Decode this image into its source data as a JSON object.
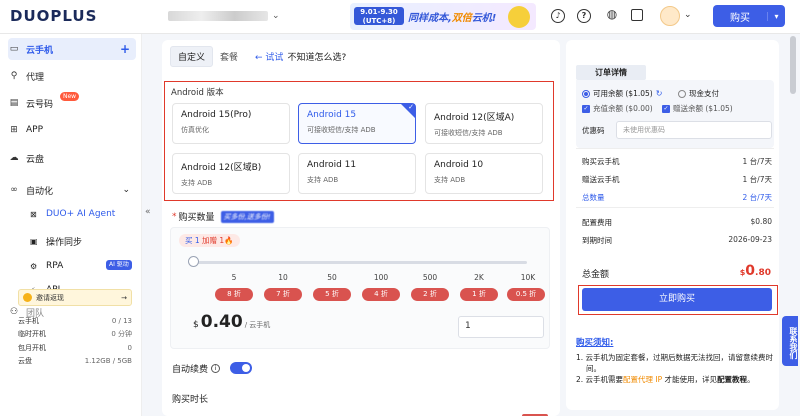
{
  "header": {
    "logo": "DUOPLUS",
    "banner": {
      "date_top": "9.01-9.30",
      "date_bottom": "(UTC+8)",
      "text_a": "同样成本,",
      "text_b": "双倍",
      "text_c": "云机!"
    },
    "buy_label": "购买",
    "buy_caret": "▾"
  },
  "sidebar": {
    "items": [
      {
        "label": "云手机",
        "icon": "phone-icon",
        "plus": "+"
      },
      {
        "label": "代理",
        "icon": "proxy-icon"
      },
      {
        "label": "云号码",
        "icon": "sim-icon",
        "badge": "New"
      },
      {
        "label": "APP",
        "icon": "grid-icon"
      },
      {
        "label": "云盘",
        "icon": "cloud-icon"
      },
      {
        "label": "自动化",
        "icon": "infinity-icon"
      }
    ],
    "sub": [
      {
        "label": "DUO+ AI Agent"
      },
      {
        "label": "操作同步"
      },
      {
        "label": "RPA",
        "badge": "AI 驱动"
      },
      {
        "label": "API"
      }
    ],
    "partial": "团队",
    "invite": "邀请返现",
    "invite_arrow": "→",
    "stats": [
      {
        "label": "云手机",
        "value": "0 / 13"
      },
      {
        "label": "临时开机",
        "value": "0 分钟"
      },
      {
        "label": "包月开机",
        "value": "0"
      },
      {
        "label": "云盘",
        "value": "1.12GB / 5GB"
      }
    ],
    "collapse": "«"
  },
  "main": {
    "tabs": [
      "自定义",
      "套餐"
    ],
    "trial": "← 试试",
    "question": "不知道怎么选?",
    "version_label": "Android 版本",
    "versions": [
      {
        "name": "Android 15(Pro)",
        "desc": "仿真优化"
      },
      {
        "name": "Android 15",
        "desc": "可接收短信/支持 ADB",
        "selected": true
      },
      {
        "name": "Android 12(区域A)",
        "desc": "可接收短信/支持 ADB"
      },
      {
        "name": "Android 12(区域B)",
        "desc": "支持 ADB"
      },
      {
        "name": "Android 11",
        "desc": "支持 ADB"
      },
      {
        "name": "Android 10",
        "desc": "支持 ADB"
      }
    ],
    "qty_label": "购买数量",
    "qty_promo": "买多份,送多份!",
    "buy_tag_a": "买 1 ",
    "buy_tag_b": "加赠 1",
    "ticks": [
      "5",
      "10",
      "50",
      "100",
      "500",
      "2K",
      "10K"
    ],
    "discounts": [
      "8 折",
      "7 折",
      "5 折",
      "4 折",
      "2 折",
      "1 折",
      "0.5 折"
    ],
    "currency": "$",
    "price": "0.40",
    "price_unit": "/ 云手机",
    "qty_value": "1",
    "auto_renew": "自动续费",
    "duration": "购买时长"
  },
  "order": {
    "title": "订单详情",
    "opt_balance": "可用余额 ($1.05)",
    "opt_cash": "现金支付",
    "chk_recharge": "充值余额 ($0.00)",
    "chk_gift": "赠送余额 ($1.05)",
    "coupon_label": "优惠码",
    "coupon_placeholder": "未使用优惠码",
    "rows": [
      {
        "label": "购买云手机",
        "value": "1 台/7天"
      },
      {
        "label": "赠送云手机",
        "value": "1 台/7天"
      },
      {
        "label": "总数量",
        "value": "2 台/7天"
      },
      {
        "label": "配置费用",
        "value": "$0.80"
      },
      {
        "label": "到期时间",
        "value": "2026-09-23"
      }
    ],
    "total_label": "总金额",
    "total_sym": "$",
    "total_int": "0",
    "total_dec": ".80",
    "buy_now": "立即购买",
    "notice_title": "购买须知:",
    "notice_1": "1. 云手机为固定套餐，过期后数据无法找回，请留意续费时间。",
    "notice_2a": "2. 云手机需要",
    "notice_2b": "配置代理 IP",
    "notice_2c": " 才能使用，详见",
    "notice_2d": "配置教程",
    "notice_2e": "。"
  },
  "float": "联系我们",
  "colors": {
    "accent": "#3d5ee6",
    "highlight": "#e0392b",
    "discount": "#d9534f"
  }
}
